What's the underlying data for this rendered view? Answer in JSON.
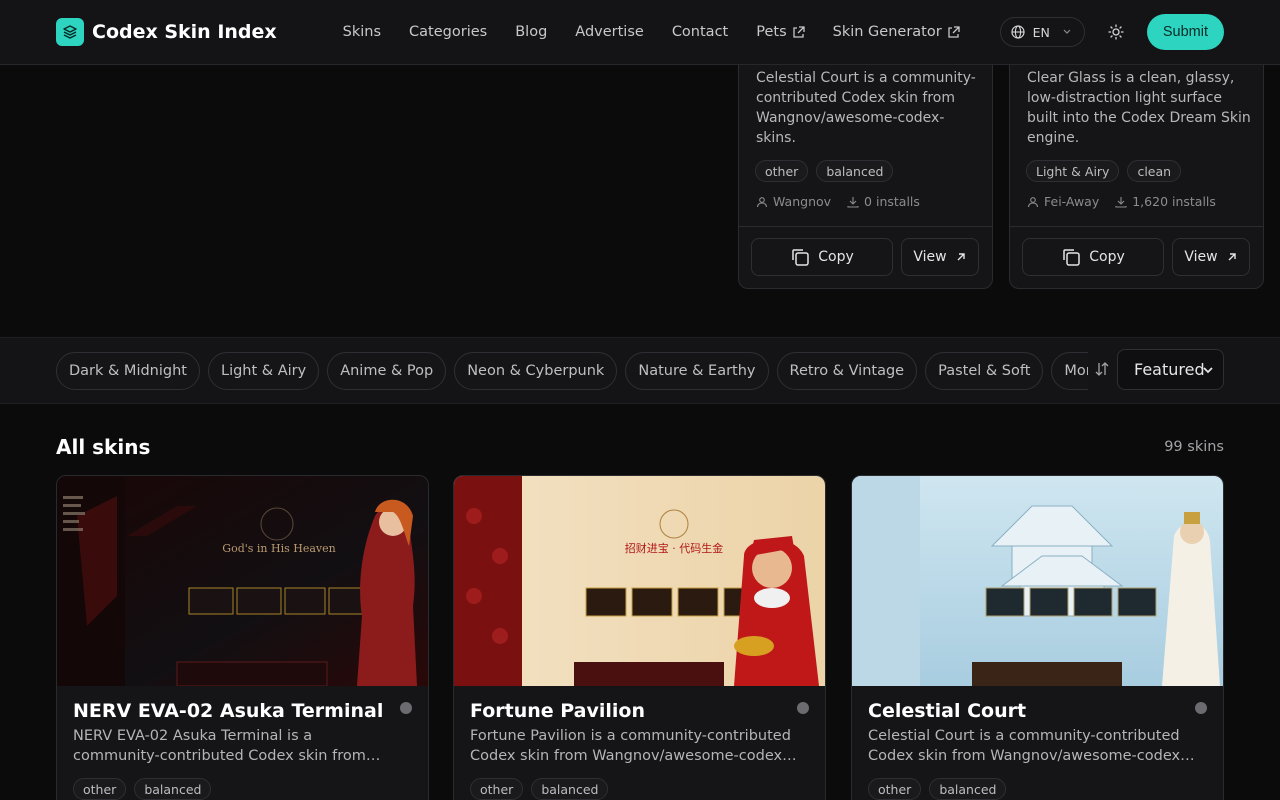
{
  "header": {
    "brand": "Codex Skin Index",
    "nav": [
      {
        "label": "Skins",
        "external": false
      },
      {
        "label": "Categories",
        "external": false
      },
      {
        "label": "Blog",
        "external": false
      },
      {
        "label": "Advertise",
        "external": false
      },
      {
        "label": "Contact",
        "external": false
      },
      {
        "label": "Pets",
        "external": true
      },
      {
        "label": "Skin Generator",
        "external": true
      }
    ],
    "language": "EN",
    "submit": "Submit"
  },
  "featured": [
    {
      "description": "Celestial Court is a community-contributed Codex skin from Wangnov/awesome-codex-skins.",
      "tags": [
        "other",
        "balanced"
      ],
      "author": "Wangnov",
      "installs": "0 installs",
      "copy": "Copy",
      "view": "View"
    },
    {
      "description": "Clear Glass is a clean, glassy, low-distraction light surface built into the Codex Dream Skin engine.",
      "tags": [
        "Light & Airy",
        "clean"
      ],
      "author": "Fei-Away",
      "installs": "1,620 installs",
      "copy": "Copy",
      "view": "View"
    }
  ],
  "filters": {
    "categories": [
      "Dark & Midnight",
      "Light & Airy",
      "Anime & Pop",
      "Neon & Cyberpunk",
      "Nature & Earthy",
      "Retro & Vintage",
      "Pastel & Soft",
      "Mono & Minimal"
    ],
    "sort": "Featured"
  },
  "all_skins": {
    "title": "All skins",
    "count": "99 skins",
    "cards": [
      {
        "title": "NERV EVA-02 Asuka Terminal",
        "description": "NERV EVA-02 Asuka Terminal is a community-contributed Codex skin from Wangnov/awesome-codex-skins.",
        "tags": [
          "other",
          "balanced"
        ],
        "preview_heading": "God's in His Heaven"
      },
      {
        "title": "Fortune Pavilion",
        "description": "Fortune Pavilion is a community-contributed Codex skin from Wangnov/awesome-codex-skins.",
        "tags": [
          "other",
          "balanced"
        ],
        "preview_heading": "招财进宝 · 代码生金"
      },
      {
        "title": "Celestial Court",
        "description": "Celestial Court is a community-contributed Codex skin from Wangnov/awesome-codex-skins.",
        "tags": [
          "other",
          "balanced"
        ],
        "preview_heading": ""
      }
    ]
  },
  "colors": {
    "accent": "#2dd4bf",
    "background": "#0b0b0c",
    "surface": "#151517"
  }
}
